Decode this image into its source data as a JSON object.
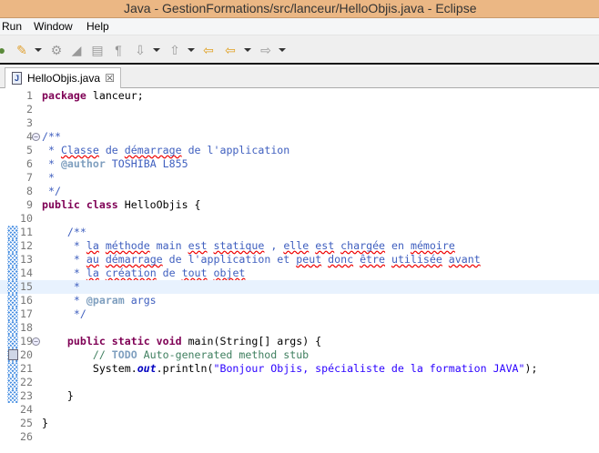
{
  "window": {
    "title": "Java - GestionFormations/src/lanceur/HelloObjis.java - Eclipse"
  },
  "menu": [
    "Run",
    "Window",
    "Help"
  ],
  "toolbar": [
    "debug-icon",
    "run-external-icon",
    "open-type-icon",
    "edit-icon",
    "toggle-mark-icon",
    "show-whitespace-icon",
    "next-annotation-icon",
    "previous-annotation-icon",
    "last-edit-icon",
    "back-icon",
    "forward-icon"
  ],
  "editor": {
    "tab": {
      "label": "HelloObjis.java",
      "close": "☒"
    },
    "current_line": 15,
    "lines": [
      [
        [
          "package",
          "kw"
        ],
        [
          " lanceur;",
          ""
        ]
      ],
      [],
      [],
      [
        [
          "/**",
          "jd"
        ]
      ],
      [
        [
          " * ",
          "jd"
        ],
        [
          "Classe",
          "jd sp"
        ],
        [
          " de ",
          "jd"
        ],
        [
          "démarrage",
          "jd sp"
        ],
        [
          " de l'application",
          "jd"
        ]
      ],
      [
        [
          " * ",
          "jd"
        ],
        [
          "@author",
          "jt"
        ],
        [
          " TOSHIBA L855",
          "jd"
        ]
      ],
      [
        [
          " * ",
          "jd"
        ]
      ],
      [
        [
          " */",
          "jd"
        ]
      ],
      [
        [
          "public",
          "kw"
        ],
        [
          " ",
          ""
        ],
        [
          "class",
          "kw"
        ],
        [
          " HelloObjis {",
          ""
        ]
      ],
      [],
      [
        [
          "    /**",
          "jd"
        ]
      ],
      [
        [
          "     * ",
          "jd"
        ],
        [
          "la",
          "jd sp"
        ],
        [
          " ",
          "jd"
        ],
        [
          "méthode",
          "jd sp"
        ],
        [
          " main ",
          "jd"
        ],
        [
          "est",
          "jd sp"
        ],
        [
          " ",
          "jd"
        ],
        [
          "statique",
          "jd sp"
        ],
        [
          " , ",
          "jd"
        ],
        [
          "elle",
          "jd sp"
        ],
        [
          " ",
          "jd"
        ],
        [
          "est",
          "jd sp"
        ],
        [
          " ",
          "jd"
        ],
        [
          "chargée",
          "jd sp"
        ],
        [
          " en ",
          "jd"
        ],
        [
          "mémoire",
          "jd sp"
        ]
      ],
      [
        [
          "     * ",
          "jd"
        ],
        [
          "au",
          "jd sp"
        ],
        [
          " ",
          "jd"
        ],
        [
          "démarrage",
          "jd sp"
        ],
        [
          " de l'application et ",
          "jd"
        ],
        [
          "peut",
          "jd sp"
        ],
        [
          " ",
          "jd"
        ],
        [
          "donc",
          "jd sp"
        ],
        [
          " ",
          "jd"
        ],
        [
          "être",
          "jd sp"
        ],
        [
          " ",
          "jd"
        ],
        [
          "utilisée",
          "jd sp"
        ],
        [
          " ",
          "jd"
        ],
        [
          "avant",
          "jd sp"
        ]
      ],
      [
        [
          "     * ",
          "jd"
        ],
        [
          "la",
          "jd sp"
        ],
        [
          " ",
          "jd"
        ],
        [
          "création",
          "jd sp"
        ],
        [
          " de ",
          "jd"
        ],
        [
          "tout",
          "jd sp"
        ],
        [
          " ",
          "jd"
        ],
        [
          "objet",
          "jd sp"
        ]
      ],
      [
        [
          "     *",
          "jd"
        ]
      ],
      [
        [
          "     * ",
          "jd"
        ],
        [
          "@param",
          "jt"
        ],
        [
          " args",
          "jd"
        ]
      ],
      [
        [
          "     */",
          "jd"
        ]
      ],
      [],
      [
        [
          "    ",
          ""
        ],
        [
          "public",
          "kw"
        ],
        [
          " ",
          ""
        ],
        [
          "static",
          "kw"
        ],
        [
          " ",
          ""
        ],
        [
          "void",
          "kw"
        ],
        [
          " main(String[] args) {",
          ""
        ]
      ],
      [
        [
          "        // ",
          "cm"
        ],
        [
          "TODO",
          "todo"
        ],
        [
          " Auto-generated method stub",
          "cm"
        ]
      ],
      [
        [
          "        System.",
          ""
        ],
        [
          "out",
          "fld"
        ],
        [
          ".println(",
          ""
        ],
        [
          "\"Bonjour Objis, spécialiste de la formation JAVA\"",
          "str"
        ],
        [
          ");",
          ""
        ]
      ],
      [],
      [
        [
          "    }",
          ""
        ]
      ],
      [],
      [
        [
          "}",
          ""
        ]
      ],
      []
    ],
    "folds": [
      4,
      19
    ],
    "changed_lines": [
      11,
      12,
      13,
      14,
      15,
      16,
      17,
      18,
      19,
      20,
      21,
      22,
      23
    ],
    "task_marker_line": 20
  }
}
